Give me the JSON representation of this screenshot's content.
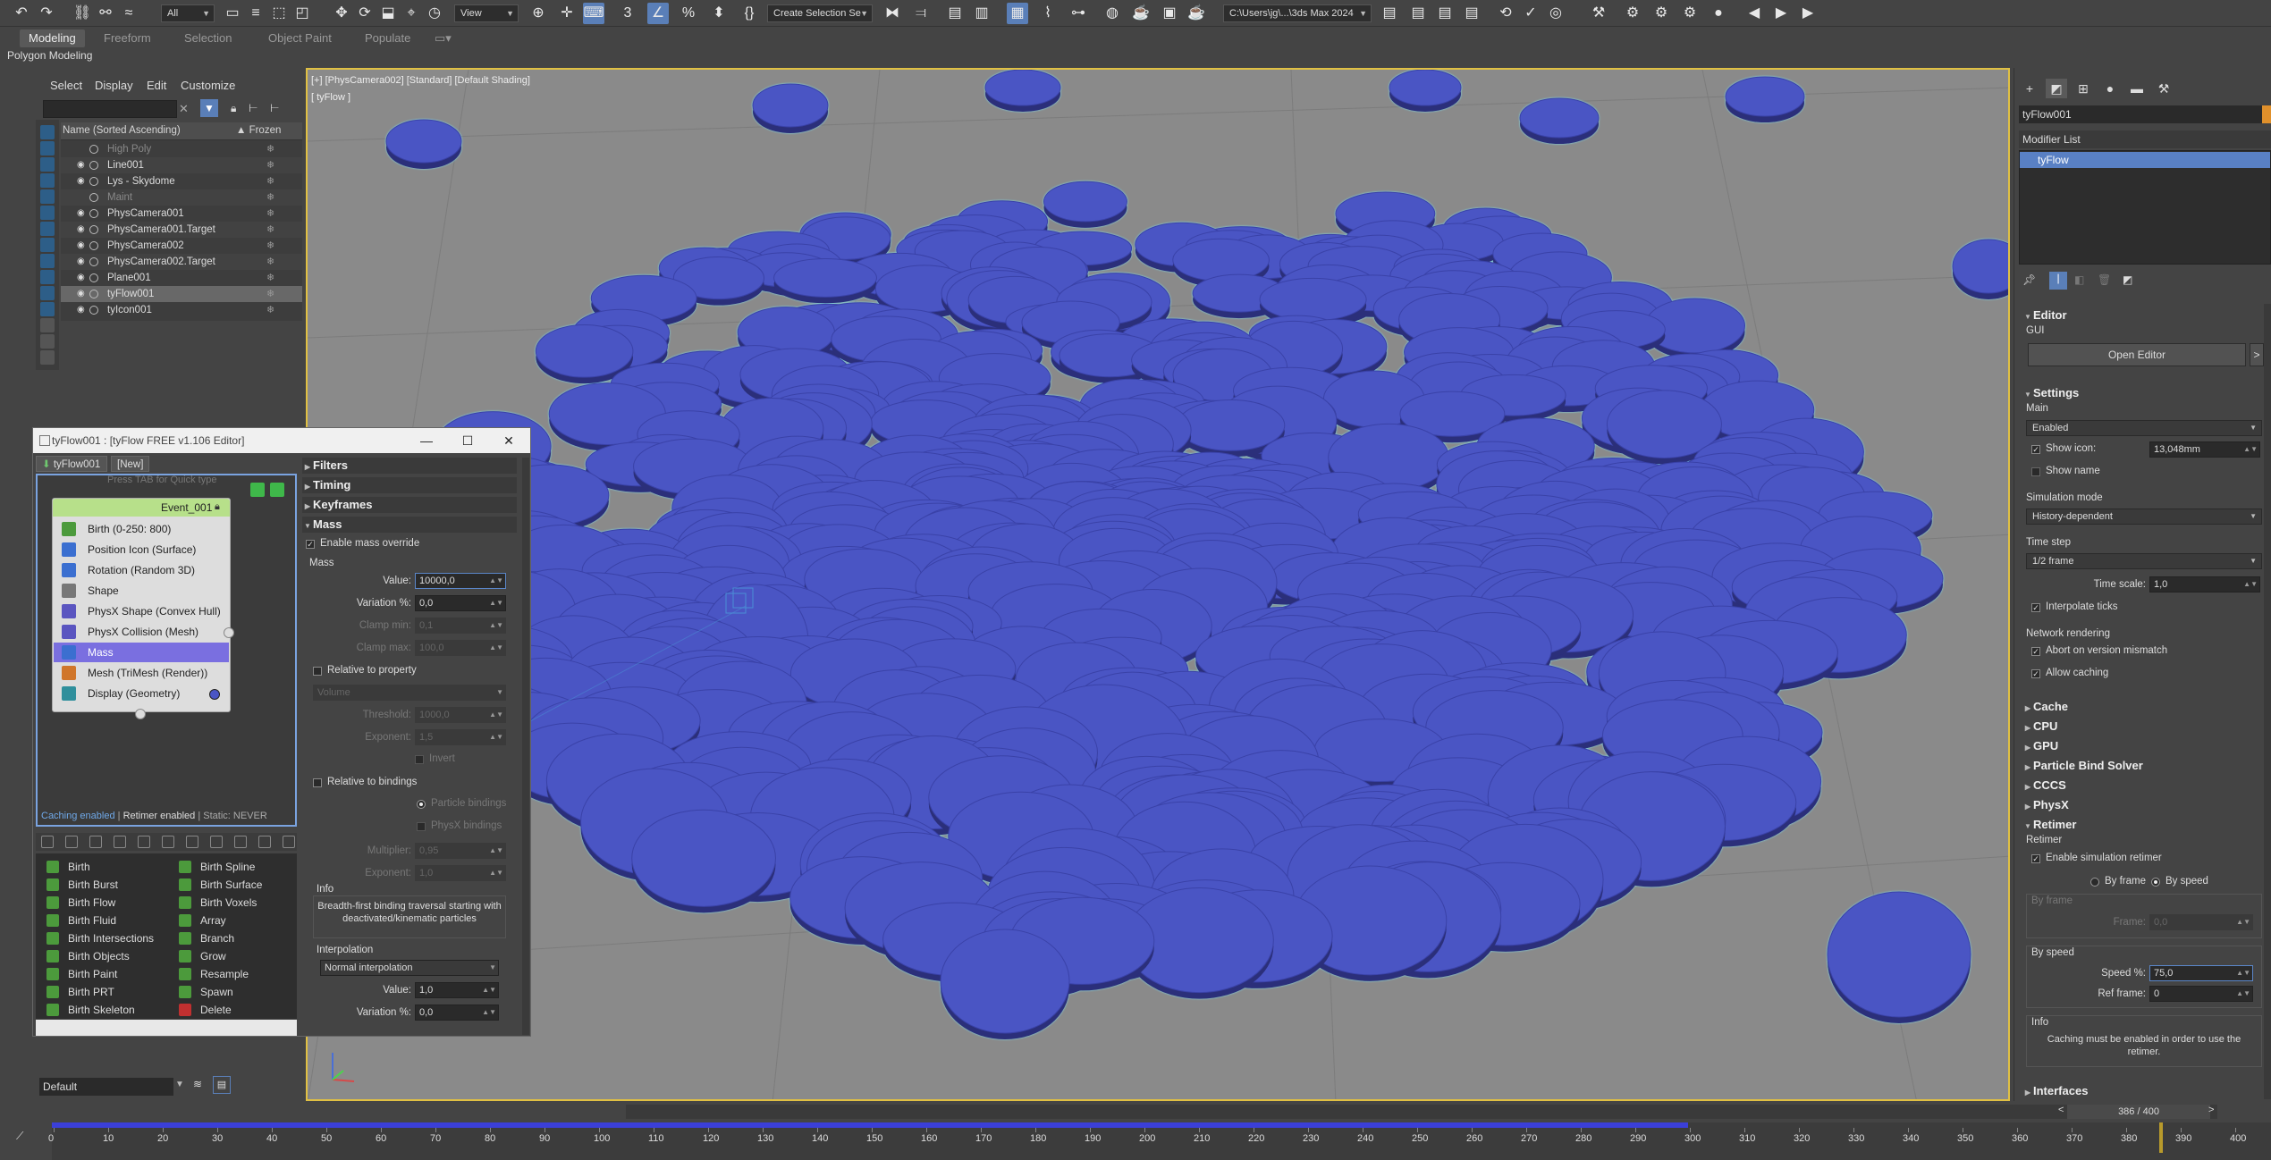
{
  "toolbar": {
    "selection_filter": "All",
    "ref_coord": "View",
    "named_selection": "Create Selection Se",
    "project_path": "C:\\Users\\jg\\...\\3ds Max 2024"
  },
  "ribbon": {
    "tabs": [
      "Modeling",
      "Freeform",
      "Selection",
      "Object Paint",
      "Populate"
    ],
    "panel_label": "Polygon Modeling"
  },
  "scene_explorer": {
    "menus": [
      "Select",
      "Display",
      "Edit",
      "Customize"
    ],
    "col_name": "Name (Sorted Ascending)",
    "col_frozen": "▲ Frozen",
    "rows": [
      {
        "name": "High Poly",
        "dim": true
      },
      {
        "name": "Line001",
        "dim": false
      },
      {
        "name": "Lys - Skydome",
        "dim": false
      },
      {
        "name": "Maint",
        "dim": true
      },
      {
        "name": "PhysCamera001",
        "dim": false
      },
      {
        "name": "PhysCamera001.Target",
        "dim": false
      },
      {
        "name": "PhysCamera002",
        "dim": false
      },
      {
        "name": "PhysCamera002.Target",
        "dim": false
      },
      {
        "name": "Plane001",
        "dim": false
      },
      {
        "name": "tyFlow001",
        "dim": false,
        "selected": true
      },
      {
        "name": "tyIcon001",
        "dim": false
      }
    ]
  },
  "viewport": {
    "label": "[+] [PhysCamera002] [Standard] [Default Shading]",
    "sublabel": "[ tyFlow ]",
    "disc_color": "#4a55c4",
    "disc_edge": "#2b2f7a",
    "highlight_color": "#7fe3f5"
  },
  "ty_editor": {
    "title": "tyFlow001 : [tyFlow FREE v1.106 Editor]",
    "tabs": [
      "tyFlow001",
      "[New]"
    ],
    "quick_type": "Press TAB for Quick type",
    "status_blue": "Caching enabled",
    "status_sep": " | ",
    "status_white": "Retimer enabled",
    "status_gray": " | Static: NEVER",
    "event": {
      "name": "Event_001",
      "operators": [
        {
          "label": "Birth (0-250: 800)",
          "color": "#4c9a3c"
        },
        {
          "label": "Position Icon (Surface)",
          "color": "#3b6fd0"
        },
        {
          "label": "Rotation (Random 3D)",
          "color": "#3b6fd0"
        },
        {
          "label": "Shape",
          "color": "#777777"
        },
        {
          "label": "PhysX Shape (Convex Hull)",
          "color": "#5a55c0"
        },
        {
          "label": "PhysX Collision (Mesh)",
          "color": "#5a55c0"
        },
        {
          "label": "Mass",
          "color": "#3b6fd0",
          "selected": true
        },
        {
          "label": "Mesh (TriMesh (Render))",
          "color": "#d0762b"
        },
        {
          "label": "Display (Geometry)",
          "color": "#2f8f9c"
        }
      ]
    },
    "palette": {
      "col1": [
        "Birth",
        "Birth Burst",
        "Birth Flow",
        "Birth Fluid",
        "Birth Intersections",
        "Birth Objects",
        "Birth Paint",
        "Birth PRT",
        "Birth Skeleton"
      ],
      "col2": [
        "Birth Spline",
        "Birth Surface",
        "Birth Voxels",
        "Array",
        "Branch",
        "Grow",
        "Resample",
        "Spawn",
        "Delete"
      ]
    },
    "props": {
      "rollouts": [
        "Filters",
        "Timing",
        "Keyframes",
        "Mass"
      ],
      "enable_mass_override": "Enable mass override",
      "mass_group": "Mass",
      "value_label": "Value:",
      "value": "10000,0",
      "variation_label": "Variation %:",
      "variation": "0,0",
      "clamp_min_label": "Clamp min:",
      "clamp_min": "0,1",
      "clamp_max_label": "Clamp max:",
      "clamp_max": "100,0",
      "relative_to_property": "Relative to property",
      "property_drop": "Volume",
      "threshold_label": "Threshold:",
      "threshold": "1000,0",
      "exponent_label": "Exponent:",
      "exponent": "1,5",
      "invert": "Invert",
      "relative_to_bindings": "Relative to bindings",
      "particle_bindings": "Particle bindings",
      "physx_bindings": "PhysX bindings",
      "multiplier_label": "Multiplier:",
      "multiplier": "0,95",
      "exponent2_label": "Exponent:",
      "exponent2": "1,0",
      "info_label": "Info",
      "info_text": "Breadth-first binding traversal starting with deactivated/kinematic particles",
      "interp_label": "Interpolation",
      "interp_drop": "Normal interpolation",
      "interp_value_label": "Value:",
      "interp_value": "1,0",
      "interp_var_label": "Variation %:",
      "interp_var": "0,0"
    }
  },
  "command_panel": {
    "object_name": "tyFlow001",
    "object_color": "#e0902b",
    "modifier_list": "Modifier List",
    "stack_item": "tyFlow",
    "editor": {
      "title": "Editor",
      "gui_label": "GUI",
      "open_editor": "Open Editor",
      "more": ">"
    },
    "settings": {
      "title": "Settings",
      "main_label": "Main",
      "enabled_drop": "Enabled",
      "show_icon": "Show icon:",
      "show_icon_value": "13,048mm",
      "show_name": "Show name",
      "sim_mode_label": "Simulation mode",
      "sim_mode": "History-dependent",
      "time_step_label": "Time step",
      "time_step": "1/2 frame",
      "time_scale_label": "Time scale:",
      "time_scale": "1,0",
      "interpolate_ticks": "Interpolate ticks",
      "network_label": "Network rendering",
      "abort_label": "Abort on version mismatch",
      "allow_caching": "Allow caching"
    },
    "collapsed": [
      "Cache",
      "CPU",
      "GPU",
      "Particle Bind Solver",
      "CCCS",
      "PhysX"
    ],
    "retimer": {
      "title": "Retimer",
      "group_label": "Retimer",
      "enable": "Enable simulation retimer",
      "by_frame": "By frame",
      "by_speed": "By speed",
      "by_frame_group": "By frame",
      "frame_label": "Frame:",
      "frame_value": "0,0",
      "by_speed_group": "By speed",
      "speed_label": "Speed %:",
      "speed_value": "75,0",
      "ref_frame_label": "Ref frame:",
      "ref_frame_value": "0",
      "info_label": "Info",
      "info_text": "Caching must be enabled in order to use the retimer."
    },
    "interfaces": "Interfaces"
  },
  "bottom": {
    "layer": "Default",
    "time_slider": "386 / 400",
    "ticks": [
      "0",
      "10",
      "20",
      "30",
      "40",
      "50",
      "60",
      "70",
      "80",
      "90",
      "100",
      "110",
      "120",
      "130",
      "140",
      "150",
      "160",
      "170",
      "180",
      "190",
      "200",
      "210",
      "220",
      "230",
      "240",
      "250",
      "260",
      "270",
      "280",
      "290",
      "300",
      "310",
      "320",
      "330",
      "340",
      "350",
      "360",
      "370",
      "380",
      "390",
      "400"
    ],
    "cached_fraction": 0.75,
    "current_frame": 386,
    "total_frames": 400
  }
}
